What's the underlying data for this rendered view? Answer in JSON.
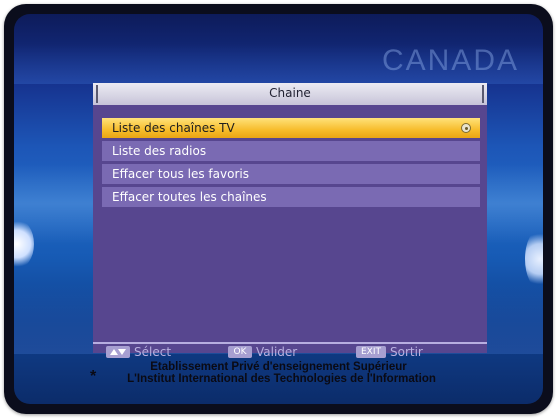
{
  "background": {
    "watermark": "CANADA"
  },
  "menu": {
    "title": "Chaine",
    "items": [
      {
        "label": "Liste des chaînes TV",
        "selected": true,
        "icon": "favorite-icon"
      },
      {
        "label": "Liste des radios",
        "selected": false
      },
      {
        "label": "Effacer tous les favoris",
        "selected": false
      },
      {
        "label": "Effacer toutes les chaînes",
        "selected": false
      }
    ]
  },
  "hints": [
    {
      "key_icon": "arrows-icon",
      "key_text": "",
      "label": "Sélect"
    },
    {
      "key_icon": "ok-key-icon",
      "key_text": "OK",
      "label": "Valider"
    },
    {
      "key_icon": "exit-key-icon",
      "key_text": "EXIT",
      "label": "Sortir"
    }
  ],
  "footer": {
    "marker": "*",
    "line1": "Etablissement Privé d'enseignement Supérieur",
    "line2": "L'Institut International des Technologies de l'Information"
  },
  "colors": {
    "menu_bg": "#57468f",
    "item_bg": "#7a6ab3",
    "selected_bg": "#f7bc2b",
    "screen_blue": "#2067c4"
  }
}
